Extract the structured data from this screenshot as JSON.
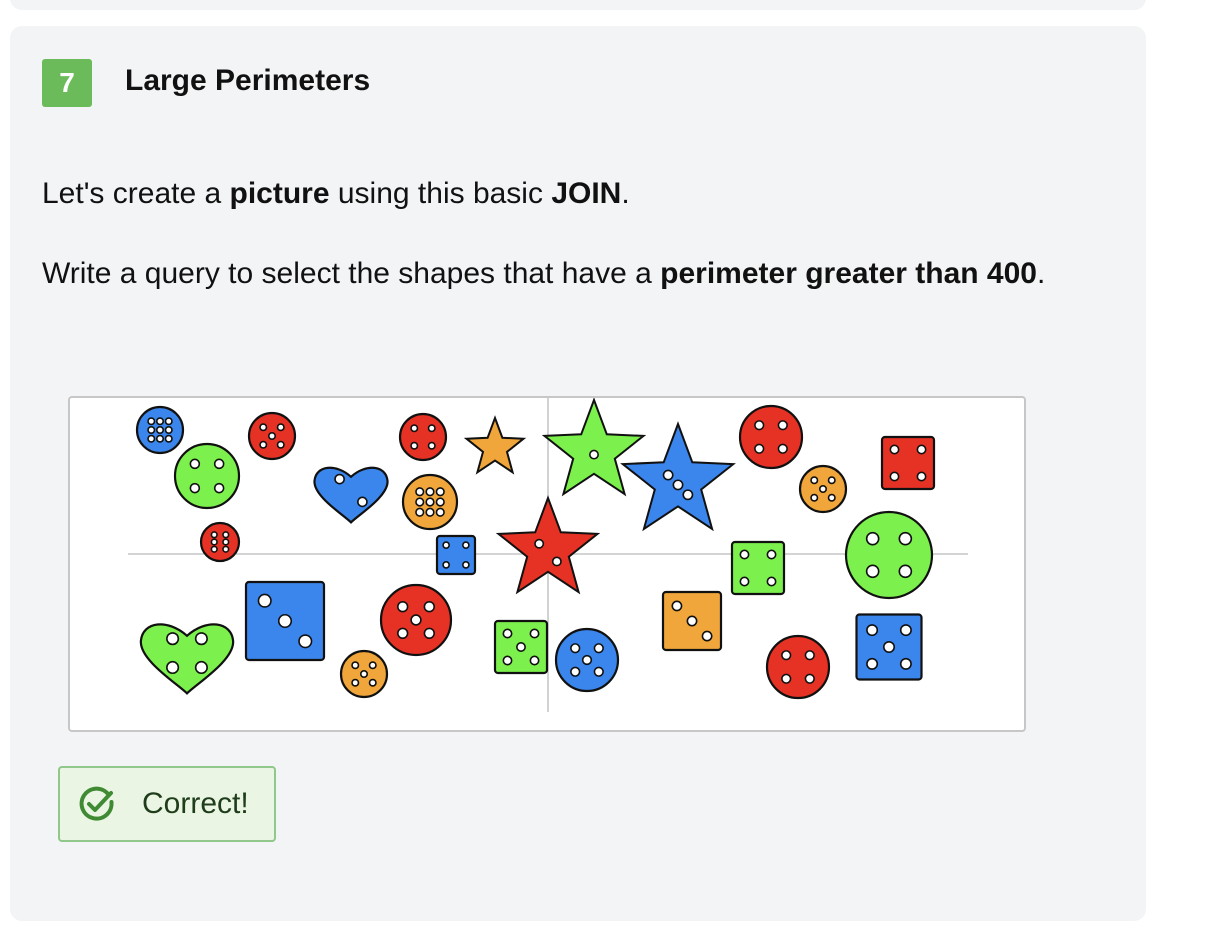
{
  "exercise": {
    "number": "7",
    "title": "Large Perimeters",
    "intro": {
      "pre": "Let's create a ",
      "bold1": "picture",
      "mid": " using this basic ",
      "bold2": "JOIN",
      "post": "."
    },
    "task": {
      "pre": "Write a query to select the shapes that have a ",
      "bold": "perimeter greater than 400",
      "post": "."
    }
  },
  "result": {
    "label": "Correct!",
    "icon": "check-circle-icon"
  },
  "colors": {
    "red": "#e53224",
    "blue": "#3b86ec",
    "green": "#7cf04c",
    "orange": "#f0a63a",
    "badge": "#6cbb5a",
    "card": "#f3f4f6",
    "success_bg": "#eaf5e4",
    "success_border": "#8fc88a"
  }
}
